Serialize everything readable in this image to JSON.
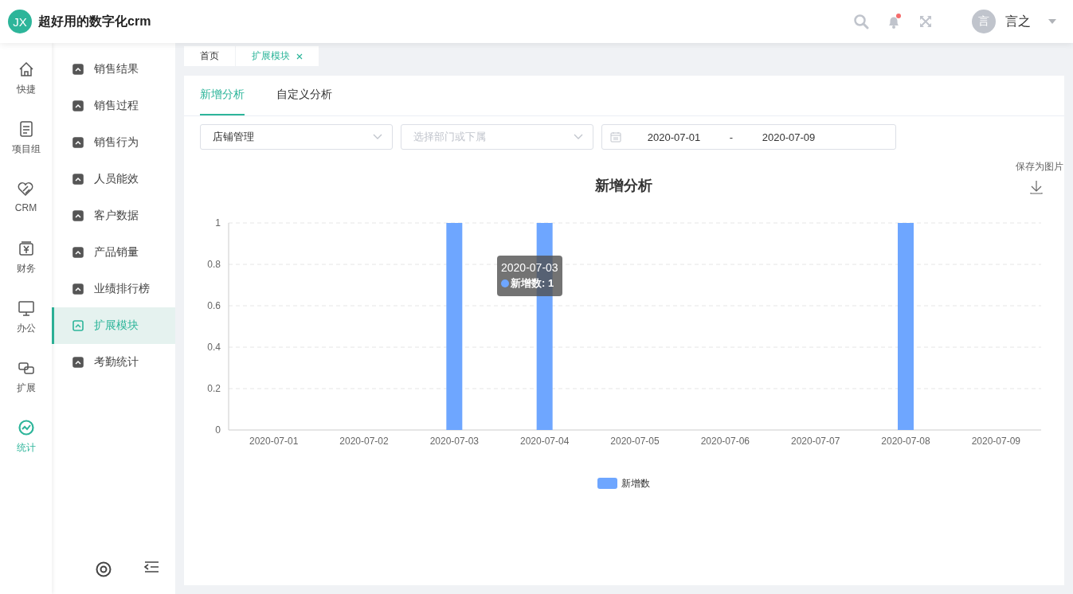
{
  "app": {
    "logo": "JX",
    "title": "超好用的数字化crm"
  },
  "header": {
    "notification_dot": true,
    "avatar": "言",
    "user": "言之"
  },
  "rail": [
    {
      "label": "快捷",
      "kind": "home",
      "selected": false
    },
    {
      "label": "项目组",
      "kind": "doc",
      "selected": false
    },
    {
      "label": "CRM",
      "kind": "heart",
      "selected": false
    },
    {
      "label": "财务",
      "kind": "yen",
      "selected": false
    },
    {
      "label": "办公",
      "kind": "monitor",
      "selected": false
    },
    {
      "label": "扩展",
      "kind": "link",
      "selected": false
    },
    {
      "label": "统计",
      "kind": "stats",
      "selected": true
    }
  ],
  "submenu": [
    {
      "label": "销售结果",
      "selected": false
    },
    {
      "label": "销售过程",
      "selected": false
    },
    {
      "label": "销售行为",
      "selected": false
    },
    {
      "label": "人员能效",
      "selected": false
    },
    {
      "label": "客户数据",
      "selected": false
    },
    {
      "label": "产品销量",
      "selected": false
    },
    {
      "label": "业绩排行榜",
      "selected": false
    },
    {
      "label": "扩展模块",
      "selected": true
    },
    {
      "label": "考勤统计",
      "selected": false
    }
  ],
  "page_tabs": [
    {
      "label": "首页",
      "selected": false,
      "closable": false
    },
    {
      "label": "扩展模块",
      "selected": true,
      "closable": true
    }
  ],
  "tabs": [
    {
      "label": "新增分析",
      "selected": true
    },
    {
      "label": "自定义分析",
      "selected": false
    }
  ],
  "filters": {
    "store": {
      "value": "店铺管理"
    },
    "department": {
      "placeholder": "选择部门或下属"
    },
    "date_from": "2020-07-01",
    "date_sep": "-",
    "date_to": "2020-07-09"
  },
  "save_image": "保存为图片",
  "chart_data": {
    "type": "bar",
    "title": "新增分析",
    "categories": [
      "2020-07-01",
      "2020-07-02",
      "2020-07-03",
      "2020-07-04",
      "2020-07-05",
      "2020-07-06",
      "2020-07-07",
      "2020-07-08",
      "2020-07-09"
    ],
    "series": [
      {
        "name": "新增数",
        "color": "#6ea6ff",
        "values": [
          0,
          0,
          1,
          1,
          0,
          0,
          0,
          1,
          0
        ]
      }
    ],
    "ylim": [
      0,
      1
    ],
    "yticks": [
      0,
      0.2,
      0.4,
      0.6,
      0.8,
      1
    ],
    "grid": true
  },
  "tooltip": {
    "title": "2020-07-03",
    "text": "新增数: 1"
  }
}
